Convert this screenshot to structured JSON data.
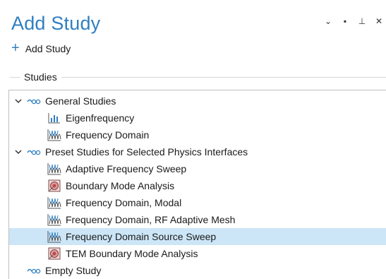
{
  "window": {
    "title": "Add Study",
    "controls": [
      "chevron-down-icon",
      "maximize-icon",
      "pin-icon",
      "close-icon"
    ],
    "control_glyphs": [
      "⌄",
      "▪",
      "⊥",
      "✕"
    ]
  },
  "toolbar": {
    "add_label": "Add Study",
    "plus_glyph": "+"
  },
  "section": {
    "label": "Studies"
  },
  "tree": [
    {
      "label": "General Studies",
      "icon": "study-group-icon",
      "level": 0,
      "expanded": true
    },
    {
      "label": "Eigenfrequency",
      "icon": "bar-chart-icon",
      "level": 1
    },
    {
      "label": "Frequency Domain",
      "icon": "frequency-domain-icon",
      "level": 1
    },
    {
      "label": "Preset Studies for Selected Physics Interfaces",
      "icon": "study-group-icon",
      "level": 0,
      "expanded": true
    },
    {
      "label": "Adaptive Frequency Sweep",
      "icon": "frequency-domain-icon",
      "level": 1
    },
    {
      "label": "Boundary Mode Analysis",
      "icon": "boundary-mode-icon",
      "level": 1
    },
    {
      "label": "Frequency Domain, Modal",
      "icon": "frequency-domain-icon",
      "level": 1
    },
    {
      "label": "Frequency Domain, RF Adaptive Mesh",
      "icon": "frequency-domain-icon",
      "level": 1
    },
    {
      "label": "Frequency Domain Source Sweep",
      "icon": "frequency-domain-icon",
      "level": 1,
      "selected": true
    },
    {
      "label": "TEM Boundary Mode Analysis",
      "icon": "boundary-mode-icon",
      "level": 1
    },
    {
      "label": "Empty Study",
      "icon": "study-group-icon",
      "level": 0
    }
  ],
  "colors": {
    "accent": "#2f7fc1",
    "selection": "#cde6f7"
  }
}
